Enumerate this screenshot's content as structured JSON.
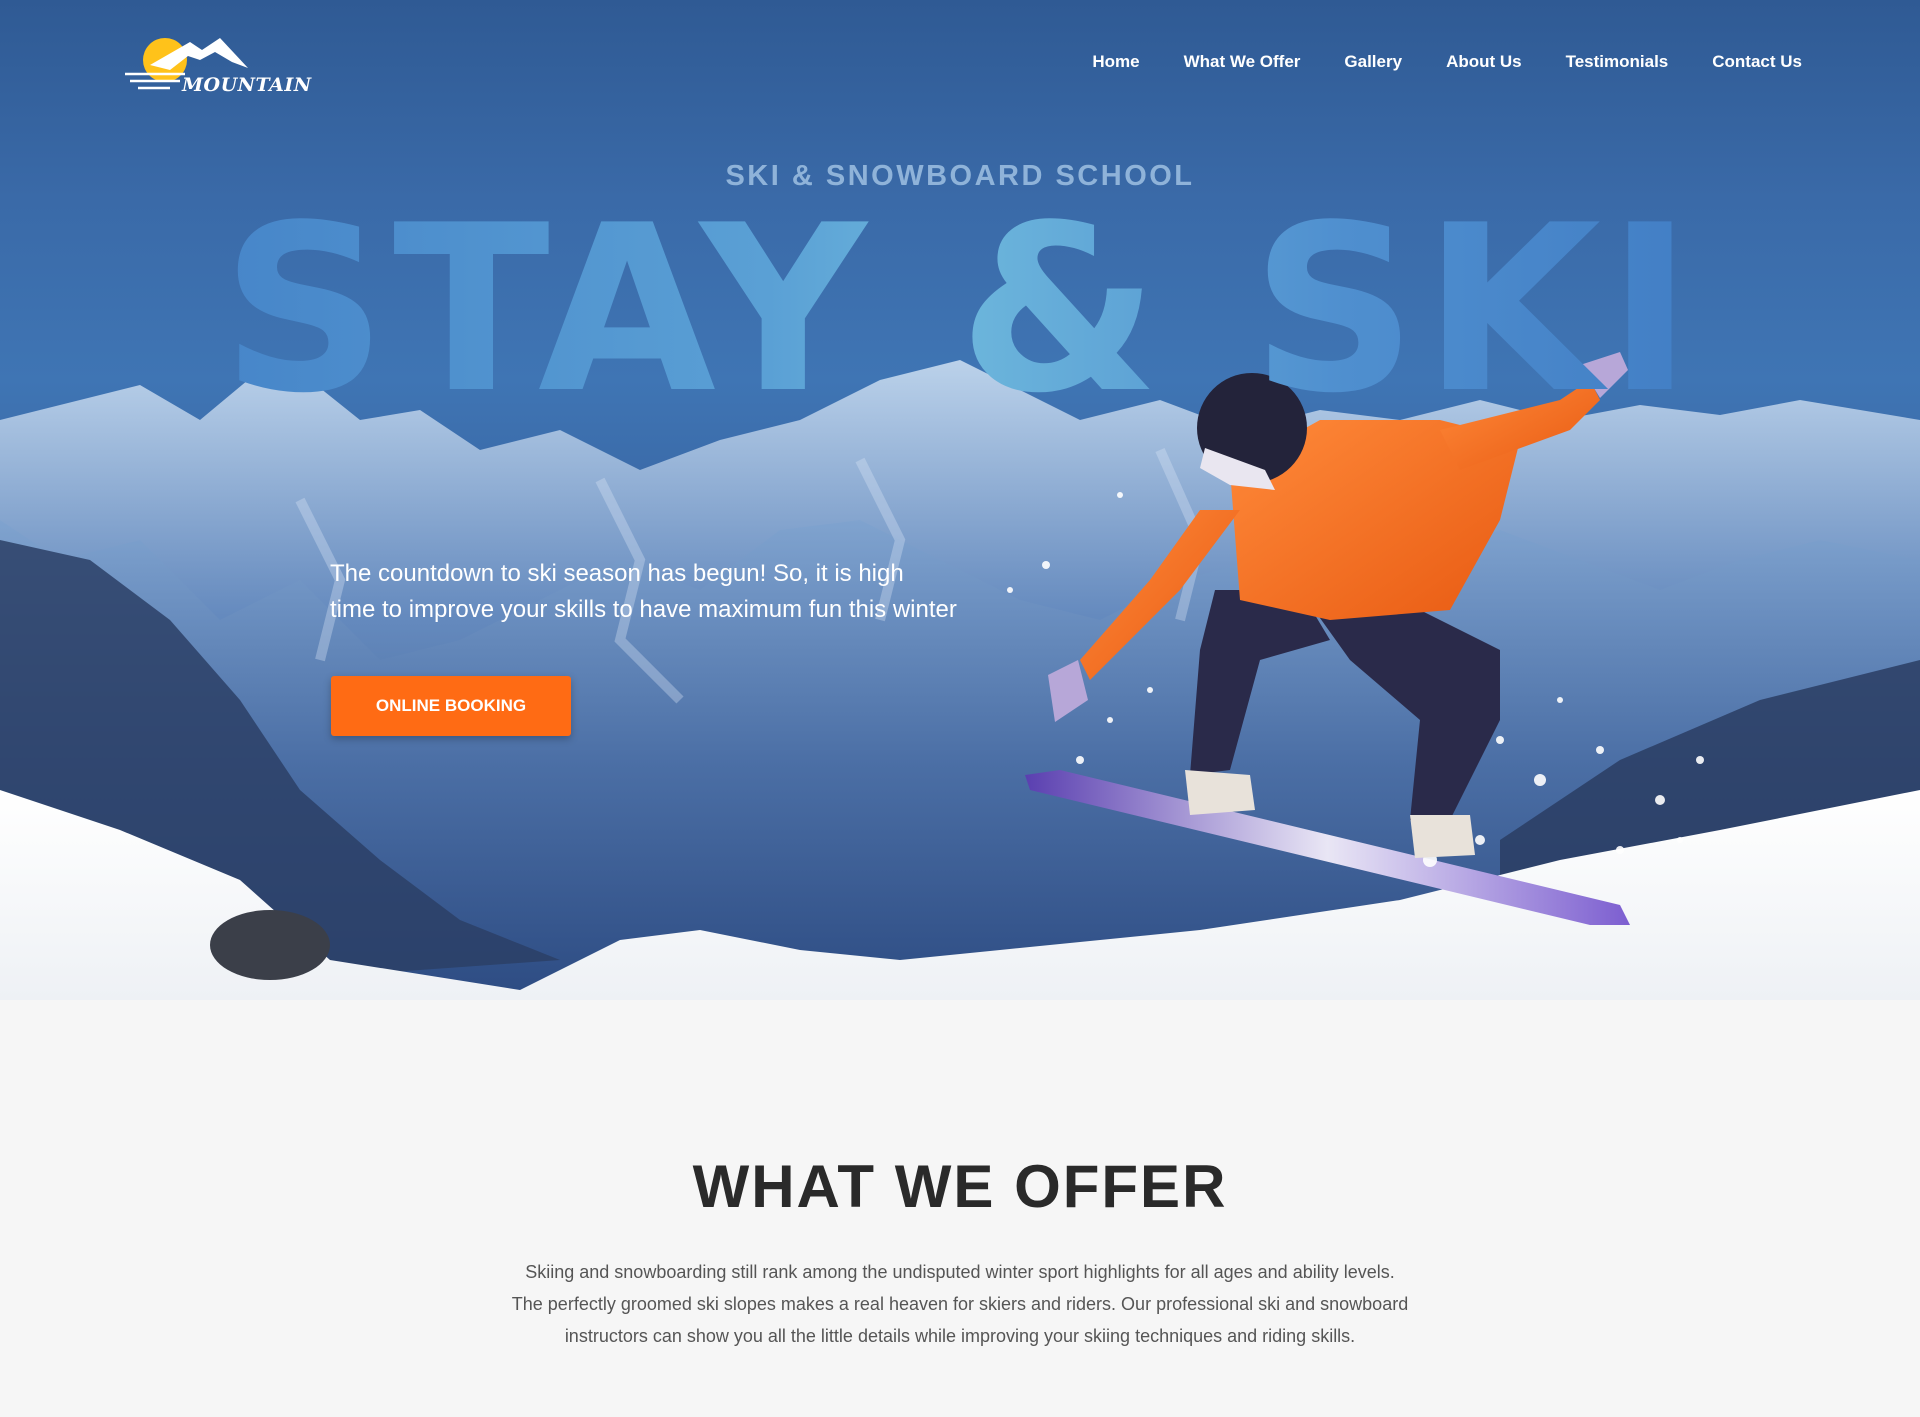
{
  "brand": {
    "logo_text": "MOUNTAIN"
  },
  "nav": {
    "items": [
      {
        "label": "Home"
      },
      {
        "label": "What We Offer"
      },
      {
        "label": "Gallery"
      },
      {
        "label": "About Us"
      },
      {
        "label": "Testimonials"
      },
      {
        "label": "Contact Us"
      }
    ]
  },
  "hero": {
    "eyebrow": "SKI & SNOWBOARD SCHOOL",
    "headline": "STAY & SKI",
    "tagline_line1": "The countdown to ski season has begun! So, it is high",
    "tagline_line2": "time to improve your skills to have maximum fun this winter",
    "cta_label": "ONLINE BOOKING"
  },
  "offer": {
    "title": "WHAT WE OFFER",
    "line1": "Skiing and snowboarding still rank among the undisputed winter sport highlights for all ages and ability levels.",
    "line2": "The perfectly groomed ski slopes makes a real heaven for skiers and riders. Our professional ski and snowboard",
    "line3": "instructors can show you all the little details while improving your skiing techniques and riding skills."
  },
  "colors": {
    "accent": "#ff6b14",
    "hero_blue": "#3a6aa8",
    "heading_dark": "#2a2a2a"
  }
}
